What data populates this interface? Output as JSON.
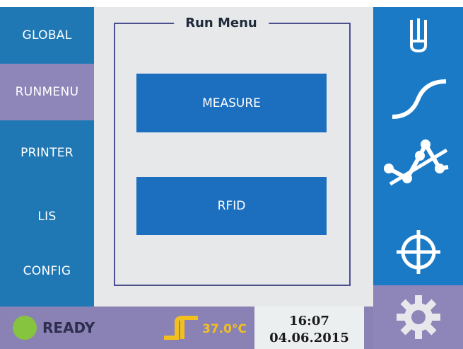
{
  "nav": {
    "items": [
      {
        "label": "GLOBAL"
      },
      {
        "label": "RUNMENU"
      },
      {
        "label": "PRINTER"
      },
      {
        "label": "LIS"
      },
      {
        "label": "CONFIG"
      }
    ],
    "active": "RUNMENU"
  },
  "main": {
    "group_title": "Run Menu",
    "buttons": [
      {
        "label": "MEASURE"
      },
      {
        "label": "RFID"
      }
    ]
  },
  "toolbar": {
    "icons": [
      "test-tube-icon",
      "curve-icon",
      "qc-chart-icon",
      "crosshair-icon",
      "gear-icon"
    ]
  },
  "status": {
    "state": "READY",
    "temperature": "37.0°C",
    "time": "16:07",
    "date": "04.06.2015"
  },
  "colors": {
    "nav_bg": "#1f78b4",
    "active_bg": "#8e86b8",
    "button_bg": "#1c6fbf",
    "status_bg": "#8a82b4",
    "ready_dot": "#86c440",
    "temp_color": "#f2c01e"
  }
}
